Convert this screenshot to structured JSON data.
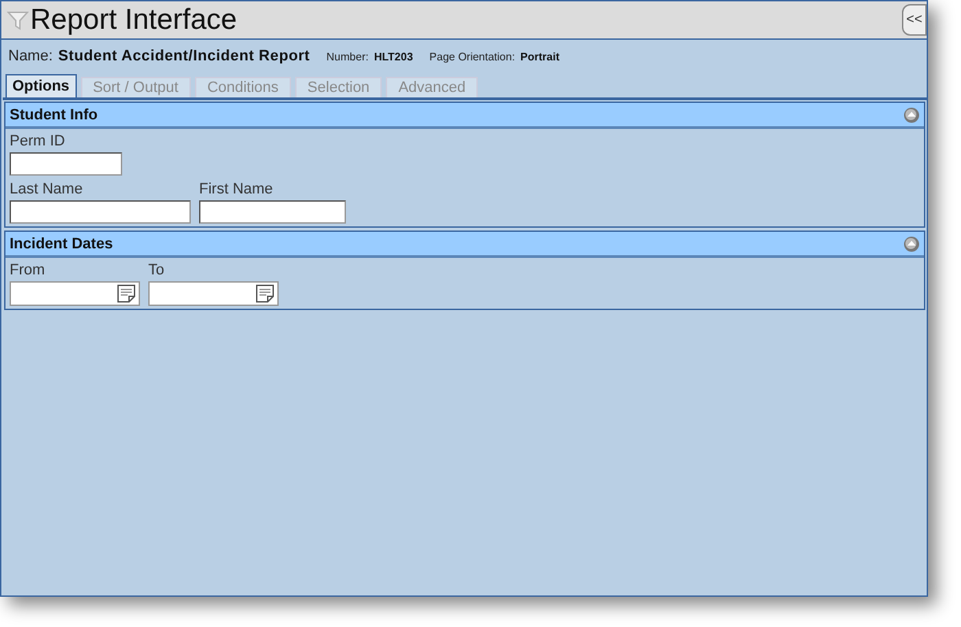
{
  "window": {
    "title": "Report Interface",
    "collapse_glyph": "<<"
  },
  "info": [
    {
      "kind": "main",
      "label": "Name:",
      "value": "Student Accident/Incident Report"
    },
    {
      "kind": "minor",
      "label": "Number:",
      "value": "HLT203"
    },
    {
      "kind": "minor",
      "label": "Page Orientation:",
      "value": "Portrait"
    }
  ],
  "tabs": [
    {
      "label": "Options",
      "selected": true
    },
    {
      "label": "Sort / Output",
      "selected": false
    },
    {
      "label": "Conditions",
      "selected": false
    },
    {
      "label": "Selection",
      "selected": false
    },
    {
      "label": "Advanced",
      "selected": false
    }
  ],
  "sections": [
    {
      "title": "Student Info",
      "expanded": true,
      "rows": [
        [
          {
            "label": "Perm ID",
            "kind": "short"
          }
        ],
        [
          {
            "label": "Last Name",
            "kind": "long"
          },
          {
            "label": "First Name",
            "kind": "medium"
          }
        ]
      ]
    },
    {
      "title": "Incident Dates",
      "expanded": true,
      "rows": [
        [
          {
            "label": "From",
            "kind": "date"
          },
          {
            "label": "To",
            "kind": "date"
          }
        ]
      ]
    }
  ]
}
